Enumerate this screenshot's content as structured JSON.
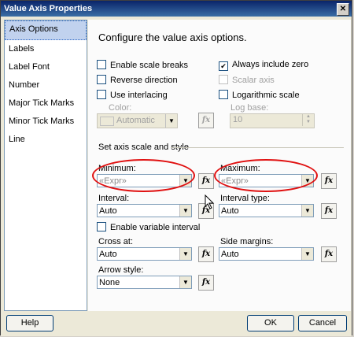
{
  "window": {
    "title": "Value Axis Properties",
    "close_glyph": "✕"
  },
  "sidebar": {
    "items": [
      {
        "label": "Axis Options",
        "selected": true
      },
      {
        "label": "Labels"
      },
      {
        "label": "Label Font"
      },
      {
        "label": "Number"
      },
      {
        "label": "Major Tick Marks"
      },
      {
        "label": "Minor Tick Marks"
      },
      {
        "label": "Line"
      }
    ]
  },
  "content": {
    "heading": "Configure the value axis options.",
    "options": {
      "enable_scale_breaks": "Enable scale breaks",
      "always_include_zero": "Always include zero",
      "reverse_direction": "Reverse direction",
      "scalar_axis": "Scalar axis",
      "use_interlacing": "Use interlacing",
      "logarithmic_scale": "Logarithmic scale",
      "color_label": "Color:",
      "color_value": "Automatic",
      "log_base_label": "Log base:",
      "log_base_value": "10",
      "check_glyph": "✔"
    },
    "scale_section_title": "Set axis scale and style",
    "minimum": {
      "label": "Minimum:",
      "value": "«Expr»"
    },
    "maximum": {
      "label": "Maximum:",
      "value": "«Expr»"
    },
    "interval": {
      "label": "Interval:",
      "value": "Auto"
    },
    "interval_type": {
      "label": "Interval type:",
      "value": "Auto"
    },
    "enable_variable_interval": "Enable variable interval",
    "cross_at": {
      "label": "Cross at:",
      "value": "Auto"
    },
    "side_margins": {
      "label": "Side margins:",
      "value": "Auto"
    },
    "arrow_style": {
      "label": "Arrow style:",
      "value": "None"
    },
    "fx_label": "fx",
    "combo_arrow": "▼"
  },
  "footer": {
    "help": "Help",
    "ok": "OK",
    "cancel": "Cancel"
  },
  "colors": {
    "highlight_oval": "#e01010",
    "selection": "#c1d2ee"
  }
}
